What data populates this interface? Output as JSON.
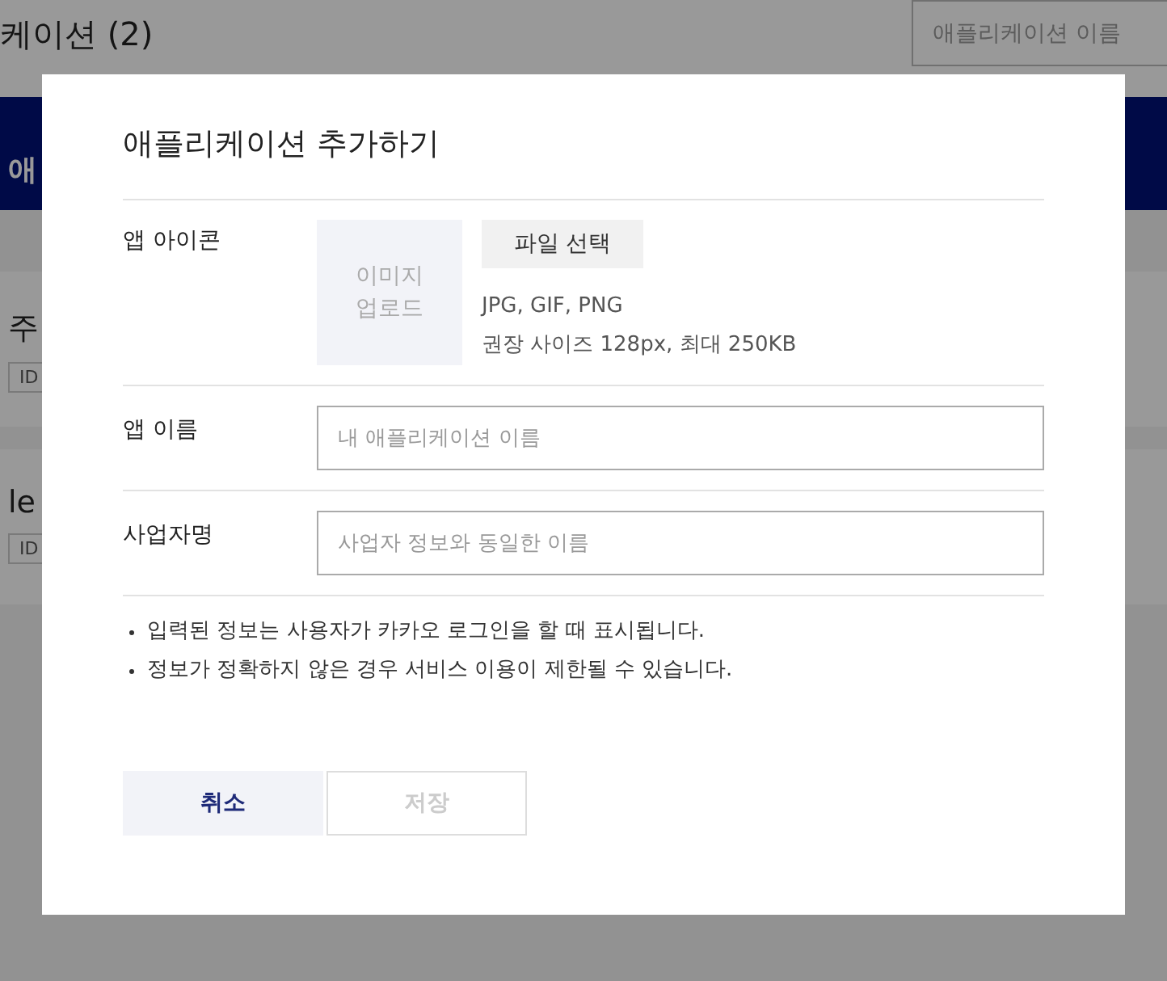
{
  "page": {
    "header_title": "케이션 (2)",
    "search": {
      "placeholder": "애플리케이션 이름"
    },
    "banner_text": "애",
    "cards": [
      {
        "title": "주",
        "tag": "ID"
      },
      {
        "title": "le",
        "tag": "ID"
      }
    ]
  },
  "dialog": {
    "title": "애플리케이션 추가하기",
    "icon_row": {
      "label": "앱 아이콘",
      "upload_box": "이미지\n업로드",
      "file_button": "파일 선택",
      "hints": [
        "JPG, GIF, PNG",
        "권장 사이즈 128px, 최대 250KB"
      ]
    },
    "fields": [
      {
        "label": "앱 이름",
        "placeholder": "내 애플리케이션 이름"
      },
      {
        "label": "사업자명",
        "placeholder": "사업자 정보와 동일한 이름"
      }
    ],
    "notes": [
      "입력된 정보는 사용자가 카카오 로그인을 할 때 표시됩니다.",
      "정보가 정확하지 않은 경우 서비스 이용이 제한될 수 있습니다."
    ],
    "buttons": [
      {
        "label": "취소",
        "kind": "cancel",
        "disabled": false
      },
      {
        "label": "저장",
        "kind": "save",
        "disabled": true
      }
    ]
  }
}
